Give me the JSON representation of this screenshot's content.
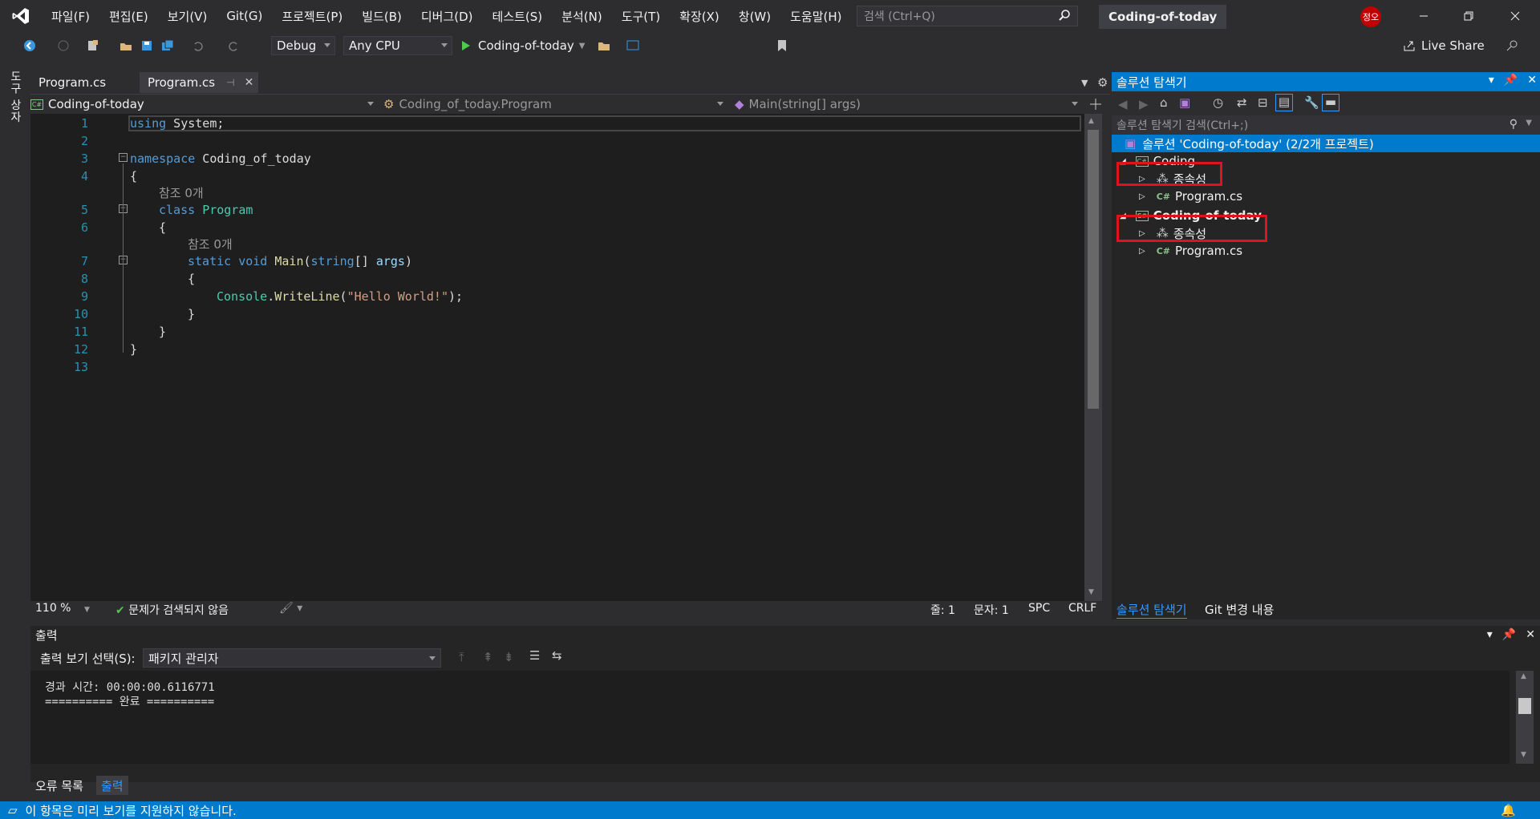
{
  "menu": {
    "items": [
      "파일(F)",
      "편집(E)",
      "보기(V)",
      "Git(G)",
      "프로젝트(P)",
      "빌드(B)",
      "디버그(D)",
      "테스트(S)",
      "분석(N)",
      "도구(T)",
      "확장(X)",
      "창(W)",
      "도움말(H)"
    ],
    "search_placeholder": "검색 (Ctrl+Q)",
    "window_title": "Coding-of-today",
    "avatar_text": "정오"
  },
  "toolbar": {
    "config": "Debug",
    "platform": "Any CPU",
    "run_label": "Coding-of-today",
    "live_share": "Live Share"
  },
  "left_strip": {
    "label": "도구 상자"
  },
  "editor": {
    "tabs": [
      {
        "label": "Program.cs",
        "active": false
      },
      {
        "label": "Program.cs",
        "active": true
      }
    ],
    "nav": {
      "project": "Coding-of-today",
      "class": "Coding_of_today.Program",
      "member": "Main(string[] args)"
    },
    "line_numbers": [
      "1",
      "2",
      "3",
      "4",
      "5",
      "6",
      "7",
      "8",
      "9",
      "10",
      "11",
      "12",
      "13"
    ],
    "code": {
      "l1_kw": "using",
      "l1_rest": " System;",
      "l3_kw": "namespace",
      "l3_rest": " Coding_of_today",
      "open_brace": "{",
      "close_brace": "}",
      "ref_label": "참조 0개",
      "l5_kw": "class",
      "l5_ty": "Program",
      "l7_kw1": "static",
      "l7_kw2": "void",
      "l7_mt": "Main",
      "l7_kw3": "string",
      "l7_pa": "args",
      "l9_ty": "Console",
      "l9_mt": "WriteLine",
      "l9_st": "\"Hello World!\""
    },
    "status": {
      "zoom": "110 %",
      "issues": "문제가 검색되지 않음",
      "line": "줄: 1",
      "col": "문자: 1",
      "spc": "SPC",
      "crlf": "CRLF"
    }
  },
  "solution_explorer": {
    "title": "솔루션 탐색기",
    "search_placeholder": "솔루션 탐색기 검색(Ctrl+;)",
    "solution_label": "솔루션 'Coding-of-today' (2/2개 프로젝트)",
    "projects": [
      {
        "name": "Coding",
        "dependencies": "종속성",
        "file": "Program.cs"
      },
      {
        "name": "Coding-of-today",
        "dependencies": "종속성",
        "file": "Program.cs"
      }
    ],
    "bottom_tabs": [
      "솔루션 탐색기",
      "Git 변경 내용"
    ],
    "highlight_color": "#e0121b"
  },
  "output": {
    "title": "출력",
    "show_from_label": "출력 보기 선택(S):",
    "source": "패키지 관리자",
    "lines": [
      "경과 시간: 00:00:00.6116771",
      "========== 완료 =========="
    ]
  },
  "bottom_tabs": [
    "오류 목록",
    "출력"
  ],
  "status_bar": {
    "message": "이 항목은 미리 보기를 지원하지 않습니다."
  },
  "colors": {
    "accent": "#007acc",
    "background": "#2d2d30",
    "editor_bg": "#1e1e1e"
  }
}
